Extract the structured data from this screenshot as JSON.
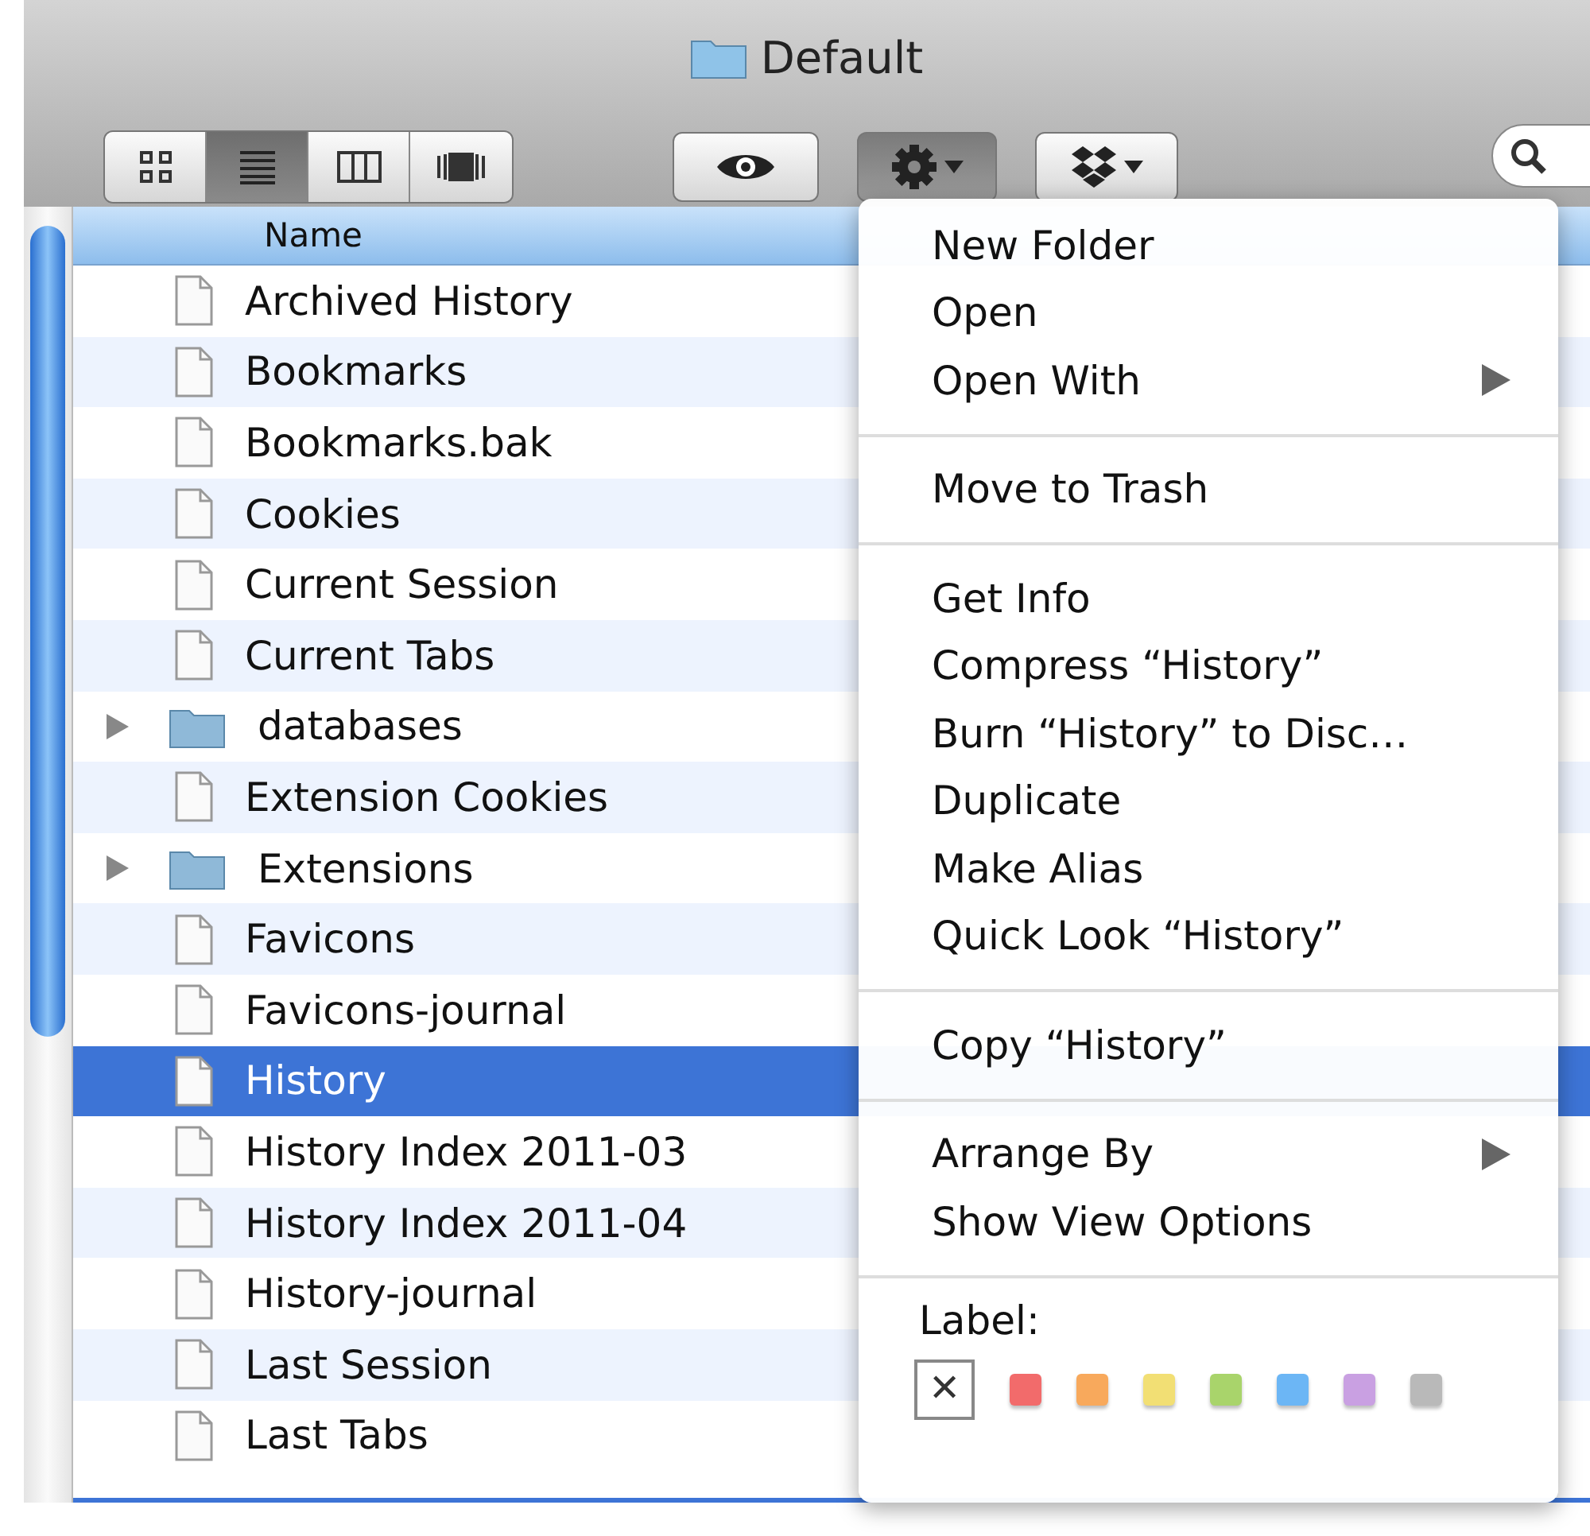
{
  "window": {
    "title": "Default"
  },
  "view_buttons": [
    {
      "kind": "icons",
      "selected": false
    },
    {
      "kind": "list",
      "selected": true
    },
    {
      "kind": "columns",
      "selected": false
    },
    {
      "kind": "coverflow",
      "selected": false
    }
  ],
  "toolbar_buttons": [
    {
      "kind": "quicklook",
      "pressed": false
    },
    {
      "kind": "action",
      "pressed": true
    },
    {
      "kind": "dropbox",
      "pressed": false
    }
  ],
  "table": {
    "columns": [
      "Name"
    ],
    "rows": [
      {
        "name": "Archived History",
        "kind": "file",
        "selected": false
      },
      {
        "name": "Bookmarks",
        "kind": "file",
        "selected": false
      },
      {
        "name": "Bookmarks.bak",
        "kind": "file",
        "selected": false
      },
      {
        "name": "Cookies",
        "kind": "file",
        "selected": false
      },
      {
        "name": "Current Session",
        "kind": "file",
        "selected": false
      },
      {
        "name": "Current Tabs",
        "kind": "file",
        "selected": false
      },
      {
        "name": "databases",
        "kind": "folder",
        "expanded": false,
        "selected": false
      },
      {
        "name": "Extension Cookies",
        "kind": "file",
        "selected": false
      },
      {
        "name": "Extensions",
        "kind": "folder",
        "expanded": false,
        "selected": false
      },
      {
        "name": "Favicons",
        "kind": "file",
        "selected": false
      },
      {
        "name": "Favicons-journal",
        "kind": "file",
        "selected": false
      },
      {
        "name": "History",
        "kind": "file",
        "selected": true
      },
      {
        "name": "History Index 2011-03",
        "kind": "file",
        "selected": false
      },
      {
        "name": "History Index 2011-04",
        "kind": "file",
        "selected": false
      },
      {
        "name": "History-journal",
        "kind": "file",
        "selected": false
      },
      {
        "name": "Last Session",
        "kind": "file",
        "selected": false
      },
      {
        "name": "Last Tabs",
        "kind": "file",
        "selected": false
      }
    ]
  },
  "context_menu": {
    "groups": [
      [
        {
          "label": "New Folder",
          "submenu": false
        },
        {
          "label": "Open",
          "submenu": false
        },
        {
          "label": "Open With",
          "submenu": true
        }
      ],
      [
        {
          "label": "Move to Trash",
          "submenu": false
        }
      ],
      [
        {
          "label": "Get Info",
          "submenu": false
        },
        {
          "label": "Compress “History”",
          "submenu": false
        },
        {
          "label": "Burn “History” to Disc…",
          "submenu": false
        },
        {
          "label": "Duplicate",
          "submenu": false
        },
        {
          "label": "Make Alias",
          "submenu": false
        },
        {
          "label": "Quick Look “History”",
          "submenu": false
        }
      ],
      [
        {
          "label": "Copy “History”",
          "submenu": false
        }
      ],
      [
        {
          "label": "Arrange By",
          "submenu": true
        },
        {
          "label": "Show View Options",
          "submenu": false
        }
      ]
    ],
    "label_section": {
      "title": "Label:",
      "none": "✕",
      "colors": [
        {
          "color": "#f26b6b"
        },
        {
          "color": "#f8a95c"
        },
        {
          "color": "#f2df74"
        },
        {
          "color": "#a9d46b"
        },
        {
          "color": "#6cb6f5"
        },
        {
          "color": "#c9a0e2"
        },
        {
          "color": "#b9b9b9"
        }
      ]
    }
  }
}
